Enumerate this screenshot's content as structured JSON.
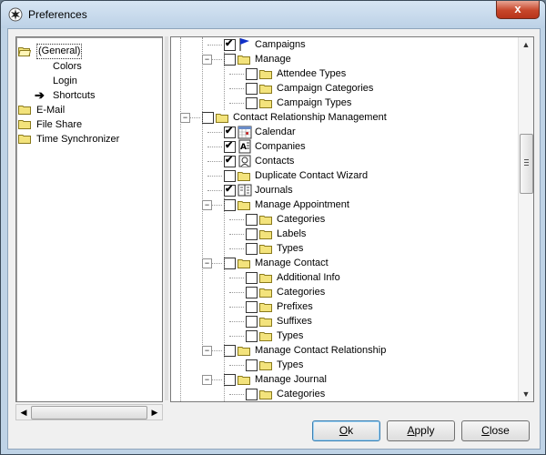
{
  "window": {
    "title": "Preferences",
    "close_glyph": "x"
  },
  "left_tree": [
    {
      "label": "(General)",
      "icon": "folder-open-icon",
      "depth": 0,
      "selected": true
    },
    {
      "label": "Colors",
      "icon": "none",
      "depth": 1
    },
    {
      "label": "Login",
      "icon": "none",
      "depth": 1
    },
    {
      "label": "Shortcuts",
      "icon": "arrow-right-icon",
      "depth": 1
    },
    {
      "label": "E-Mail",
      "icon": "folder-icon",
      "depth": 0
    },
    {
      "label": "File Share",
      "icon": "folder-icon",
      "depth": 0
    },
    {
      "label": "Time Synchronizer",
      "icon": "folder-icon",
      "depth": 0
    }
  ],
  "right_tree": [
    {
      "label": "Campaigns",
      "depth": 2,
      "checked": true,
      "icon": "flag-icon",
      "expander": ""
    },
    {
      "label": "Manage",
      "depth": 2,
      "checked": false,
      "icon": "folder-icon",
      "expander": "−"
    },
    {
      "label": "Attendee Types",
      "depth": 3,
      "checked": false,
      "icon": "folder-icon",
      "expander": ""
    },
    {
      "label": "Campaign Categories",
      "depth": 3,
      "checked": false,
      "icon": "folder-icon",
      "expander": ""
    },
    {
      "label": "Campaign Types",
      "depth": 3,
      "checked": false,
      "icon": "folder-icon",
      "expander": ""
    },
    {
      "label": "Contact Relationship Management",
      "depth": 1,
      "checked": false,
      "icon": "folder-icon",
      "expander": "−"
    },
    {
      "label": "Calendar",
      "depth": 2,
      "checked": true,
      "icon": "calendar-icon",
      "expander": ""
    },
    {
      "label": "Companies",
      "depth": 2,
      "checked": true,
      "icon": "companies-icon",
      "expander": ""
    },
    {
      "label": "Contacts",
      "depth": 2,
      "checked": true,
      "icon": "contacts-icon",
      "expander": ""
    },
    {
      "label": "Duplicate Contact Wizard",
      "depth": 2,
      "checked": false,
      "icon": "folder-icon",
      "expander": ""
    },
    {
      "label": "Journals",
      "depth": 2,
      "checked": true,
      "icon": "journal-icon",
      "expander": ""
    },
    {
      "label": "Manage Appointment",
      "depth": 2,
      "checked": false,
      "icon": "folder-icon",
      "expander": "−"
    },
    {
      "label": "Categories",
      "depth": 3,
      "checked": false,
      "icon": "folder-icon",
      "expander": ""
    },
    {
      "label": "Labels",
      "depth": 3,
      "checked": false,
      "icon": "folder-icon",
      "expander": ""
    },
    {
      "label": "Types",
      "depth": 3,
      "checked": false,
      "icon": "folder-icon",
      "expander": ""
    },
    {
      "label": "Manage Contact",
      "depth": 2,
      "checked": false,
      "icon": "folder-icon",
      "expander": "−"
    },
    {
      "label": "Additional Info",
      "depth": 3,
      "checked": false,
      "icon": "folder-icon",
      "expander": ""
    },
    {
      "label": "Categories",
      "depth": 3,
      "checked": false,
      "icon": "folder-icon",
      "expander": ""
    },
    {
      "label": "Prefixes",
      "depth": 3,
      "checked": false,
      "icon": "folder-icon",
      "expander": ""
    },
    {
      "label": "Suffixes",
      "depth": 3,
      "checked": false,
      "icon": "folder-icon",
      "expander": ""
    },
    {
      "label": "Types",
      "depth": 3,
      "checked": false,
      "icon": "folder-icon",
      "expander": ""
    },
    {
      "label": "Manage Contact Relationship",
      "depth": 2,
      "checked": false,
      "icon": "folder-icon",
      "expander": "−"
    },
    {
      "label": "Types",
      "depth": 3,
      "checked": false,
      "icon": "folder-icon",
      "expander": ""
    },
    {
      "label": "Manage Journal",
      "depth": 2,
      "checked": false,
      "icon": "folder-icon",
      "expander": "−"
    },
    {
      "label": "Categories",
      "depth": 3,
      "checked": false,
      "icon": "folder-icon",
      "expander": ""
    }
  ],
  "buttons": {
    "ok": {
      "accel": "O",
      "rest": "k"
    },
    "apply": {
      "accel": "A",
      "rest": "pply"
    },
    "close": {
      "accel": "C",
      "rest": "lose"
    }
  },
  "colors": {
    "folder": "#f3e37c",
    "folder_edge": "#8a7a1c",
    "accent": "#3c7fb1"
  }
}
